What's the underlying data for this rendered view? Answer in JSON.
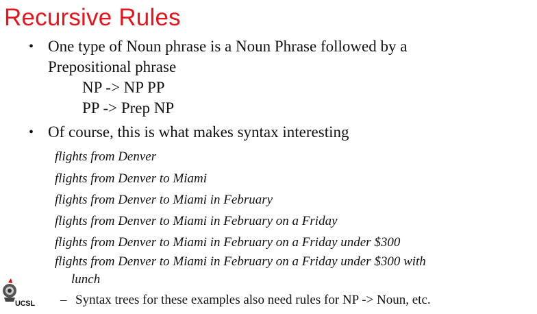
{
  "title": "Recursive Rules",
  "bullets": [
    {
      "text_line1": "One type of Noun phrase is a Noun Phrase followed by a",
      "text_line2": "Prepositional phrase",
      "rules": [
        "NP -> NP PP",
        "PP -> Prep NP"
      ]
    },
    {
      "text": "Of course, this is what makes syntax interesting",
      "examples": [
        "flights from Denver",
        "flights from Denver to Miami",
        "flights from Denver to Miami in February",
        "flights from Denver to Miami in February on a Friday",
        "flights from Denver to Miami in February on a Friday under $300",
        "flights from Denver to Miami in February on a Friday under $300 with",
        "lunch"
      ],
      "sub_bullet": "Syntax trees for these examples also need rules for NP -> Noun, etc."
    }
  ],
  "logo": {
    "text": "UCSL",
    "icon": "ucsl-logo-icon"
  }
}
